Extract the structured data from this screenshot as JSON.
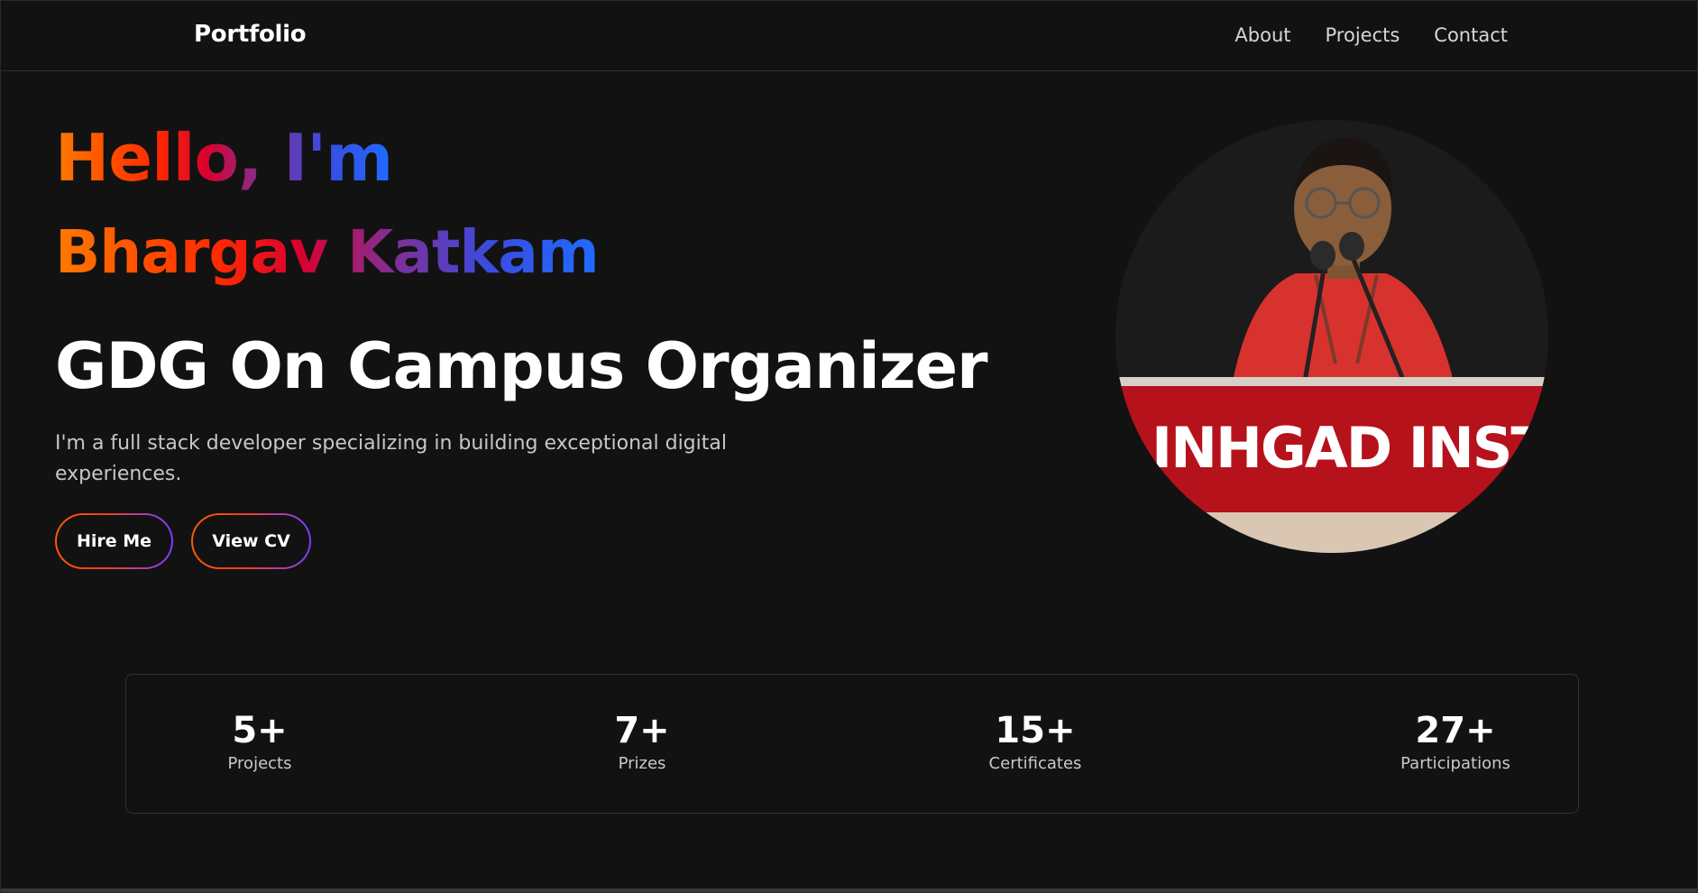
{
  "navbar": {
    "brand": "Portfolio",
    "links": [
      "About",
      "Projects",
      "Contact"
    ]
  },
  "hero": {
    "greeting": "Hello, I'm",
    "name": "Bhargav Katkam",
    "role": "GDG On Campus Organizer",
    "tagline": "I'm a full stack developer specializing in building exceptional digital experiences.",
    "buttons": {
      "hire": "Hire Me",
      "cv": "View CV"
    },
    "photo_banner_text": "INHGAD INSTITU"
  },
  "stats": [
    {
      "value": "5+",
      "label": "Projects"
    },
    {
      "value": "7+",
      "label": "Prizes"
    },
    {
      "value": "15+",
      "label": "Certificates"
    },
    {
      "value": "27+",
      "label": "Participations"
    }
  ],
  "colors": {
    "background": "#121212",
    "gradient_start": "#ff7a00",
    "gradient_mid": "#d9002f",
    "gradient_end": "#1f6bff",
    "text_primary": "#ffffff",
    "text_muted": "#c7c7c7"
  }
}
